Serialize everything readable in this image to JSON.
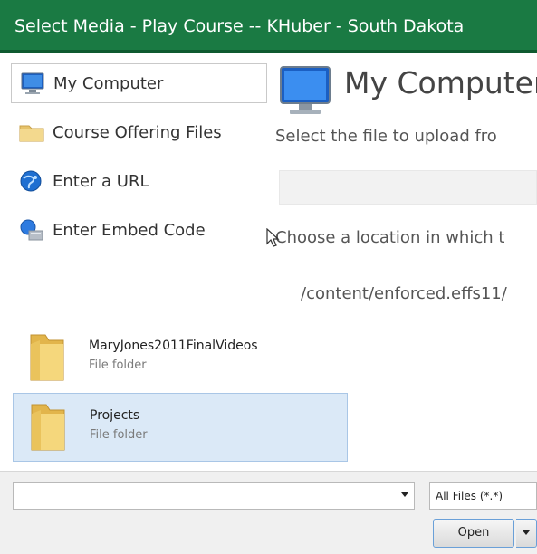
{
  "window": {
    "title": "Select Media - Play Course -- KHuber - South Dakota"
  },
  "sidebar": {
    "items": [
      {
        "label": "My Computer",
        "icon": "monitor-icon",
        "selected": true
      },
      {
        "label": "Course Offering Files",
        "icon": "folder-icon",
        "selected": false
      },
      {
        "label": "Enter a URL",
        "icon": "globe-icon",
        "selected": false
      },
      {
        "label": "Enter Embed Code",
        "icon": "embed-icon",
        "selected": false
      }
    ]
  },
  "main": {
    "title": "My Computer",
    "instruction": "Select the file to upload fro",
    "location_prompt": "Choose a location in which t",
    "path": "/content/enforced.effs11/"
  },
  "file_dialog": {
    "folders": [
      {
        "name": "MaryJones2011FinalVideos",
        "type": "File folder",
        "selected": false
      },
      {
        "name": "Projects",
        "type": "File folder",
        "selected": true
      }
    ],
    "filename_value": "",
    "filter": "All Files (*.*)",
    "open_label": "Open"
  },
  "colors": {
    "titlebar": "#1a7a43",
    "selection": "#dbe9f7"
  }
}
